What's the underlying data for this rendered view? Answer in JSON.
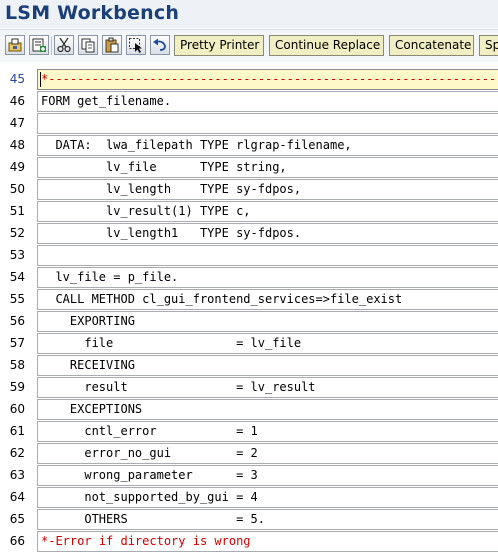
{
  "app": {
    "title": "LSM Workbench"
  },
  "toolbar": {
    "icons": [
      "code-template-icon",
      "insert-icon",
      "cut-icon",
      "copy-icon",
      "paste-icon",
      "select-icon",
      "undo-icon"
    ],
    "buttons": {
      "pretty_printer": "Pretty Printer",
      "continue_replace": "Continue Replace",
      "concatenate": "Concatenate",
      "split_partial": "Sp"
    }
  },
  "editor": {
    "current_line": 45,
    "lines": [
      {
        "num": "45",
        "text": "*----------------------------------------------------------------------"
      },
      {
        "num": "46",
        "text": "FORM get_filename."
      },
      {
        "num": "47",
        "text": ""
      },
      {
        "num": "48",
        "text": "  DATA:  lwa_filepath TYPE rlgrap-filename,"
      },
      {
        "num": "49",
        "text": "         lv_file      TYPE string,"
      },
      {
        "num": "50",
        "text": "         lv_length    TYPE sy-fdpos,"
      },
      {
        "num": "51",
        "text": "         lv_result(1) TYPE c,"
      },
      {
        "num": "52",
        "text": "         lv_length1   TYPE sy-fdpos."
      },
      {
        "num": "53",
        "text": ""
      },
      {
        "num": "54",
        "text": "  lv_file = p_file."
      },
      {
        "num": "55",
        "text": "  CALL METHOD cl_gui_frontend_services=>file_exist"
      },
      {
        "num": "56",
        "text": "    EXPORTING"
      },
      {
        "num": "57",
        "text": "      file                 = lv_file"
      },
      {
        "num": "58",
        "text": "    RECEIVING"
      },
      {
        "num": "59",
        "text": "      result               = lv_result"
      },
      {
        "num": "60",
        "text": "    EXCEPTIONS"
      },
      {
        "num": "61",
        "text": "      cntl_error           = 1"
      },
      {
        "num": "62",
        "text": "      error_no_gui         = 2"
      },
      {
        "num": "63",
        "text": "      wrong_parameter      = 3"
      },
      {
        "num": "64",
        "text": "      not_supported_by_gui = 4"
      },
      {
        "num": "65",
        "text": "      OTHERS               = 5."
      },
      {
        "num": "66",
        "text": "*-Error if directory is wrong"
      }
    ]
  },
  "colors": {
    "title": "#1b3f78",
    "active_line": "#fff8c8",
    "comment": "#d40000",
    "current_line_number": "#2547a8",
    "button_face": "#f2eec4"
  }
}
